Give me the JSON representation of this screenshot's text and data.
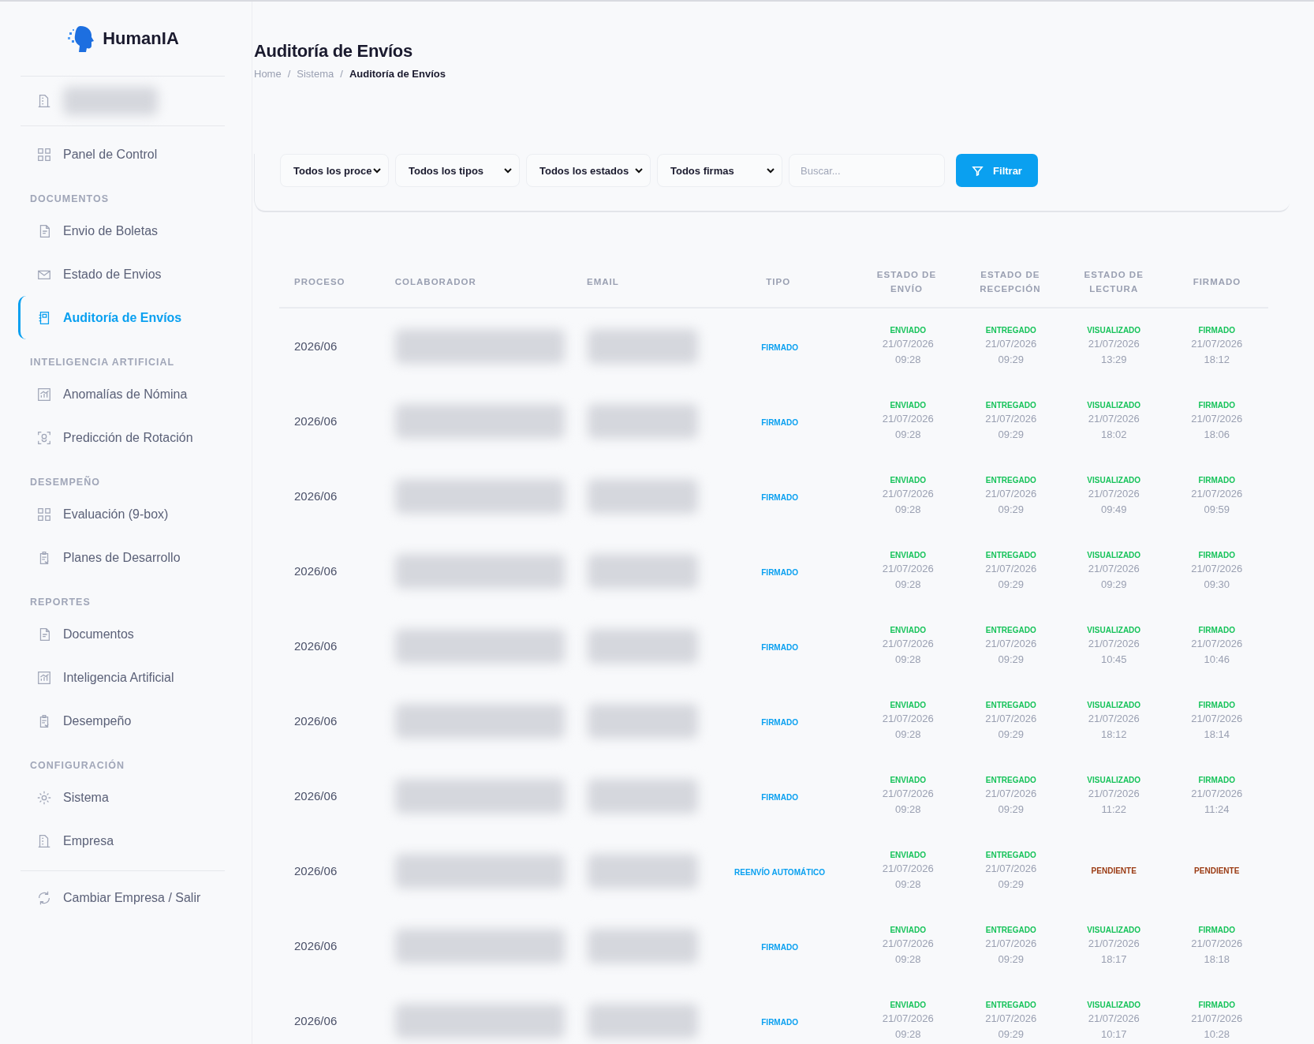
{
  "sidebar": {
    "brand": "HumanIA",
    "top_items": [
      {
        "label": "Panel de Control",
        "selected": false
      }
    ],
    "sections": [
      {
        "title": "DOCUMENTOS",
        "items": [
          {
            "label": "Envio de Boletas",
            "selected": false
          },
          {
            "label": "Estado de Envios",
            "selected": false
          },
          {
            "label": "Auditoría de Envíos",
            "selected": true
          }
        ]
      },
      {
        "title": "INTELIGENCIA ARTIFICIAL",
        "items": [
          {
            "label": "Anomalías de Nómina",
            "selected": false
          },
          {
            "label": "Predicción de Rotación",
            "selected": false
          }
        ]
      },
      {
        "title": "DESEMPEÑO",
        "items": [
          {
            "label": "Evaluación (9-box)",
            "selected": false
          },
          {
            "label": "Planes de Desarrollo",
            "selected": false
          }
        ]
      },
      {
        "title": "REPORTES",
        "items": [
          {
            "label": "Documentos",
            "selected": false
          },
          {
            "label": "Inteligencia Artificial",
            "selected": false
          },
          {
            "label": "Desempeño",
            "selected": false
          }
        ]
      },
      {
        "title": "CONFIGURACIÓN",
        "items": [
          {
            "label": "Sistema",
            "selected": false
          },
          {
            "label": "Empresa",
            "selected": false
          }
        ]
      }
    ],
    "footer_item": {
      "label": "Cambiar Empresa / Salir"
    }
  },
  "page": {
    "title": "Auditoría de Envíos",
    "breadcrumb": [
      {
        "kind": "link",
        "text": "Home"
      },
      {
        "kind": "separator",
        "text": "/"
      },
      {
        "kind": "link",
        "text": "Sistema"
      },
      {
        "kind": "separator",
        "text": "/"
      },
      {
        "kind": "current",
        "text": "Auditoría de Envíos"
      }
    ]
  },
  "filters": {
    "selects": [
      "Todos los proce",
      "Todos los tipos",
      "Todos los estados",
      "Todos firmas"
    ],
    "search": {
      "placeholder": "Buscar..."
    },
    "button": "Filtrar"
  },
  "table": {
    "columns": [
      "PROCESO",
      "COLABORADOR",
      "EMAIL",
      "TIPO",
      "ESTADO DE ENVÍO",
      "ESTADO DE RECEPCIÓN",
      "ESTADO DE LECTURA",
      "FIRMADO"
    ],
    "rows": [
      {
        "proceso": "2026/06",
        "tipo": "FIRMADO",
        "statuses": [
          {
            "kind": "done",
            "label": "ENVIADO",
            "date": "21/07/2026",
            "time": "09:28"
          },
          {
            "kind": "done",
            "label": "ENTREGADO",
            "date": "21/07/2026",
            "time": "09:29"
          },
          {
            "kind": "done",
            "label": "VISUALIZADO",
            "date": "21/07/2026",
            "time": "13:29"
          },
          {
            "kind": "done",
            "label": "FIRMADO",
            "date": "21/07/2026",
            "time": "18:12"
          }
        ]
      },
      {
        "proceso": "2026/06",
        "tipo": "FIRMADO",
        "statuses": [
          {
            "kind": "done",
            "label": "ENVIADO",
            "date": "21/07/2026",
            "time": "09:28"
          },
          {
            "kind": "done",
            "label": "ENTREGADO",
            "date": "21/07/2026",
            "time": "09:29"
          },
          {
            "kind": "done",
            "label": "VISUALIZADO",
            "date": "21/07/2026",
            "time": "18:02"
          },
          {
            "kind": "done",
            "label": "FIRMADO",
            "date": "21/07/2026",
            "time": "18:06"
          }
        ]
      },
      {
        "proceso": "2026/06",
        "tipo": "FIRMADO",
        "statuses": [
          {
            "kind": "done",
            "label": "ENVIADO",
            "date": "21/07/2026",
            "time": "09:28"
          },
          {
            "kind": "done",
            "label": "ENTREGADO",
            "date": "21/07/2026",
            "time": "09:29"
          },
          {
            "kind": "done",
            "label": "VISUALIZADO",
            "date": "21/07/2026",
            "time": "09:49"
          },
          {
            "kind": "done",
            "label": "FIRMADO",
            "date": "21/07/2026",
            "time": "09:59"
          }
        ]
      },
      {
        "proceso": "2026/06",
        "tipo": "FIRMADO",
        "statuses": [
          {
            "kind": "done",
            "label": "ENVIADO",
            "date": "21/07/2026",
            "time": "09:28"
          },
          {
            "kind": "done",
            "label": "ENTREGADO",
            "date": "21/07/2026",
            "time": "09:29"
          },
          {
            "kind": "done",
            "label": "VISUALIZADO",
            "date": "21/07/2026",
            "time": "09:29"
          },
          {
            "kind": "done",
            "label": "FIRMADO",
            "date": "21/07/2026",
            "time": "09:30"
          }
        ]
      },
      {
        "proceso": "2026/06",
        "tipo": "FIRMADO",
        "statuses": [
          {
            "kind": "done",
            "label": "ENVIADO",
            "date": "21/07/2026",
            "time": "09:28"
          },
          {
            "kind": "done",
            "label": "ENTREGADO",
            "date": "21/07/2026",
            "time": "09:29"
          },
          {
            "kind": "done",
            "label": "VISUALIZADO",
            "date": "21/07/2026",
            "time": "10:45"
          },
          {
            "kind": "done",
            "label": "FIRMADO",
            "date": "21/07/2026",
            "time": "10:46"
          }
        ]
      },
      {
        "proceso": "2026/06",
        "tipo": "FIRMADO",
        "statuses": [
          {
            "kind": "done",
            "label": "ENVIADO",
            "date": "21/07/2026",
            "time": "09:28"
          },
          {
            "kind": "done",
            "label": "ENTREGADO",
            "date": "21/07/2026",
            "time": "09:29"
          },
          {
            "kind": "done",
            "label": "VISUALIZADO",
            "date": "21/07/2026",
            "time": "18:12"
          },
          {
            "kind": "done",
            "label": "FIRMADO",
            "date": "21/07/2026",
            "time": "18:14"
          }
        ]
      },
      {
        "proceso": "2026/06",
        "tipo": "FIRMADO",
        "statuses": [
          {
            "kind": "done",
            "label": "ENVIADO",
            "date": "21/07/2026",
            "time": "09:28"
          },
          {
            "kind": "done",
            "label": "ENTREGADO",
            "date": "21/07/2026",
            "time": "09:29"
          },
          {
            "kind": "done",
            "label": "VISUALIZADO",
            "date": "21/07/2026",
            "time": "11:22"
          },
          {
            "kind": "done",
            "label": "FIRMADO",
            "date": "21/07/2026",
            "time": "11:24"
          }
        ]
      },
      {
        "proceso": "2026/06",
        "tipo": "REENVÍO AUTOMÁTICO",
        "statuses": [
          {
            "kind": "done",
            "label": "ENVIADO",
            "date": "21/07/2026",
            "time": "09:28"
          },
          {
            "kind": "done",
            "label": "ENTREGADO",
            "date": "21/07/2026",
            "time": "09:29"
          },
          {
            "kind": "pending",
            "label": "PENDIENTE"
          },
          {
            "kind": "pending",
            "label": "PENDIENTE"
          }
        ]
      },
      {
        "proceso": "2026/06",
        "tipo": "FIRMADO",
        "statuses": [
          {
            "kind": "done",
            "label": "ENVIADO",
            "date": "21/07/2026",
            "time": "09:28"
          },
          {
            "kind": "done",
            "label": "ENTREGADO",
            "date": "21/07/2026",
            "time": "09:29"
          },
          {
            "kind": "done",
            "label": "VISUALIZADO",
            "date": "21/07/2026",
            "time": "18:17"
          },
          {
            "kind": "done",
            "label": "FIRMADO",
            "date": "21/07/2026",
            "time": "18:18"
          }
        ]
      },
      {
        "proceso": "2026/06",
        "tipo": "FIRMADO",
        "statuses": [
          {
            "kind": "done",
            "label": "ENVIADO",
            "date": "21/07/2026",
            "time": "09:28"
          },
          {
            "kind": "done",
            "label": "ENTREGADO",
            "date": "21/07/2026",
            "time": "09:29"
          },
          {
            "kind": "done",
            "label": "VISUALIZADO",
            "date": "21/07/2026",
            "time": "10:17"
          },
          {
            "kind": "done",
            "label": "FIRMADO",
            "date": "21/07/2026",
            "time": "10:28"
          }
        ]
      }
    ]
  }
}
